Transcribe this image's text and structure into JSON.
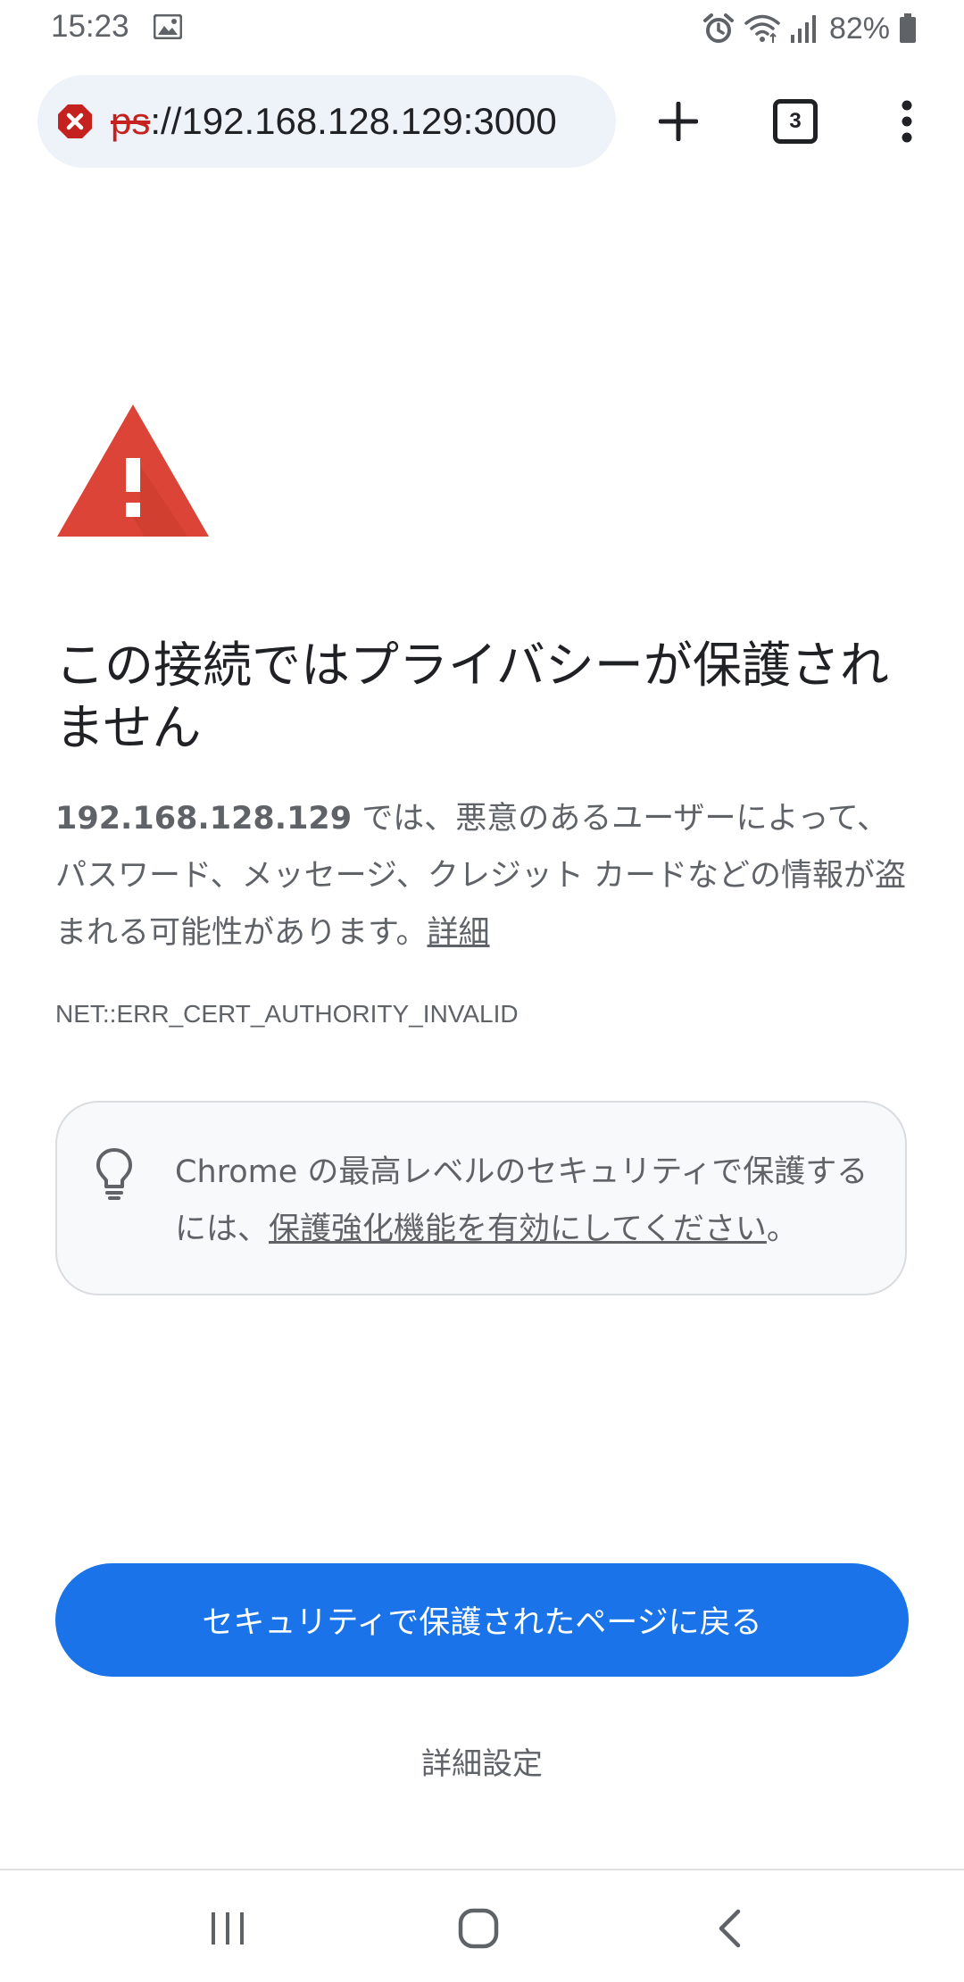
{
  "status_bar": {
    "time": "15:23",
    "battery_percent": "82%",
    "icons": [
      "gallery-icon",
      "alarm-icon",
      "wifi-icon",
      "signal-icon",
      "battery-icon"
    ]
  },
  "toolbar": {
    "url_scheme_visible": "ps",
    "url_rest": "://192.168.128.129:3000",
    "security_state": "not-secure-error",
    "tab_count": "3",
    "icons": [
      "error-icon",
      "plus-icon",
      "tab-switcher-icon",
      "more-vert-icon"
    ]
  },
  "interstitial": {
    "heading": "この接続ではプライバシーが保護されません",
    "host": "192.168.128.129",
    "description_text": " では、悪意のあるユーザーによって、パスワード、メッセージ、クレジット カードなどの情報が盗まれる可能性があります。",
    "learn_more_link": "詳細",
    "error_code": "NET::ERR_CERT_AUTHORITY_INVALID",
    "tip_text_before": "Chrome の最高レベルのセキュリティで保護するには、",
    "tip_link": "保護強化機能を有効にしてください",
    "tip_text_after": "。",
    "primary_button_label": "セキュリティで保護されたページに戻る",
    "advanced_button_label": "詳細設定"
  },
  "nav_bar": {
    "buttons": [
      "recents",
      "home",
      "back"
    ]
  },
  "colors": {
    "warning_red": "#db4437",
    "primary_blue": "#1a73e8",
    "error_scheme_red": "#c5221f",
    "url_pill_bg": "#eef2f9"
  }
}
